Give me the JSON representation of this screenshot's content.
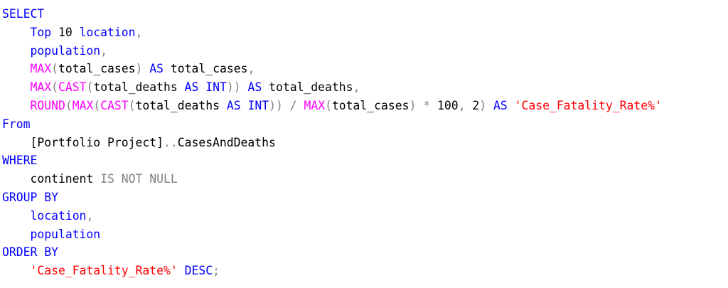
{
  "editor": {
    "lines": [
      [
        {
          "t": "SELECT",
          "c": "kw"
        }
      ],
      [
        {
          "t": "    ",
          "c": "plain"
        },
        {
          "t": "Top",
          "c": "kw"
        },
        {
          "t": " 10 ",
          "c": "plain"
        },
        {
          "t": "location",
          "c": "kw"
        },
        {
          "t": ",",
          "c": "gray"
        }
      ],
      [
        {
          "t": "    ",
          "c": "plain"
        },
        {
          "t": "population",
          "c": "kw"
        },
        {
          "t": ",",
          "c": "gray"
        }
      ],
      [
        {
          "t": "    ",
          "c": "plain"
        },
        {
          "t": "MAX",
          "c": "fn"
        },
        {
          "t": "(",
          "c": "gray"
        },
        {
          "t": "total_cases",
          "c": "plain"
        },
        {
          "t": ")",
          "c": "gray"
        },
        {
          "t": " ",
          "c": "plain"
        },
        {
          "t": "AS",
          "c": "kw"
        },
        {
          "t": " total_cases",
          "c": "plain"
        },
        {
          "t": ",",
          "c": "gray"
        }
      ],
      [
        {
          "t": "    ",
          "c": "plain"
        },
        {
          "t": "MAX",
          "c": "fn"
        },
        {
          "t": "(",
          "c": "gray"
        },
        {
          "t": "CAST",
          "c": "fn"
        },
        {
          "t": "(",
          "c": "gray"
        },
        {
          "t": "total_deaths ",
          "c": "plain"
        },
        {
          "t": "AS",
          "c": "kw"
        },
        {
          "t": " ",
          "c": "plain"
        },
        {
          "t": "INT",
          "c": "kw"
        },
        {
          "t": "))",
          "c": "gray"
        },
        {
          "t": " ",
          "c": "plain"
        },
        {
          "t": "AS",
          "c": "kw"
        },
        {
          "t": " total_deaths",
          "c": "plain"
        },
        {
          "t": ",",
          "c": "gray"
        }
      ],
      [
        {
          "t": "    ",
          "c": "plain"
        },
        {
          "t": "ROUND",
          "c": "fn"
        },
        {
          "t": "(",
          "c": "gray"
        },
        {
          "t": "MAX",
          "c": "fn"
        },
        {
          "t": "(",
          "c": "gray"
        },
        {
          "t": "CAST",
          "c": "fn"
        },
        {
          "t": "(",
          "c": "gray"
        },
        {
          "t": "total_deaths ",
          "c": "plain"
        },
        {
          "t": "AS",
          "c": "kw"
        },
        {
          "t": " ",
          "c": "plain"
        },
        {
          "t": "INT",
          "c": "kw"
        },
        {
          "t": "))",
          "c": "gray"
        },
        {
          "t": " ",
          "c": "plain"
        },
        {
          "t": "/",
          "c": "gray"
        },
        {
          "t": " ",
          "c": "plain"
        },
        {
          "t": "MAX",
          "c": "fn"
        },
        {
          "t": "(",
          "c": "gray"
        },
        {
          "t": "total_cases",
          "c": "plain"
        },
        {
          "t": ")",
          "c": "gray"
        },
        {
          "t": " ",
          "c": "plain"
        },
        {
          "t": "*",
          "c": "gray"
        },
        {
          "t": " 100",
          "c": "plain"
        },
        {
          "t": ",",
          "c": "gray"
        },
        {
          "t": " 2",
          "c": "plain"
        },
        {
          "t": ")",
          "c": "gray"
        },
        {
          "t": " ",
          "c": "plain"
        },
        {
          "t": "AS",
          "c": "kw"
        },
        {
          "t": " ",
          "c": "plain"
        },
        {
          "t": "'Case_Fatality_Rate%'",
          "c": "str"
        }
      ],
      [
        {
          "t": "From",
          "c": "kw"
        }
      ],
      [
        {
          "t": "    [Portfolio Project]",
          "c": "plain"
        },
        {
          "t": "..",
          "c": "gray"
        },
        {
          "t": "CasesAndDeaths",
          "c": "plain"
        }
      ],
      [
        {
          "t": "WHERE",
          "c": "kw"
        }
      ],
      [
        {
          "t": "    continent ",
          "c": "plain"
        },
        {
          "t": "IS NOT NULL",
          "c": "gray"
        }
      ],
      [
        {
          "t": "GROUP BY",
          "c": "kw"
        }
      ],
      [
        {
          "t": "    ",
          "c": "plain"
        },
        {
          "t": "location",
          "c": "kw"
        },
        {
          "t": ",",
          "c": "gray"
        }
      ],
      [
        {
          "t": "    ",
          "c": "plain"
        },
        {
          "t": "population",
          "c": "kw"
        }
      ],
      [
        {
          "t": "ORDER BY",
          "c": "kw"
        }
      ],
      [
        {
          "t": "    ",
          "c": "plain"
        },
        {
          "t": "'Case_Fatality_Rate%'",
          "c": "str"
        },
        {
          "t": " ",
          "c": "plain"
        },
        {
          "t": "DESC",
          "c": "kw"
        },
        {
          "t": ";",
          "c": "gray"
        }
      ]
    ]
  },
  "colors": {
    "keyword": "#0000ff",
    "function": "#ff00ff",
    "string": "#ff0000",
    "operator": "#808080",
    "identifier": "#000000",
    "background": "#ffffff"
  }
}
